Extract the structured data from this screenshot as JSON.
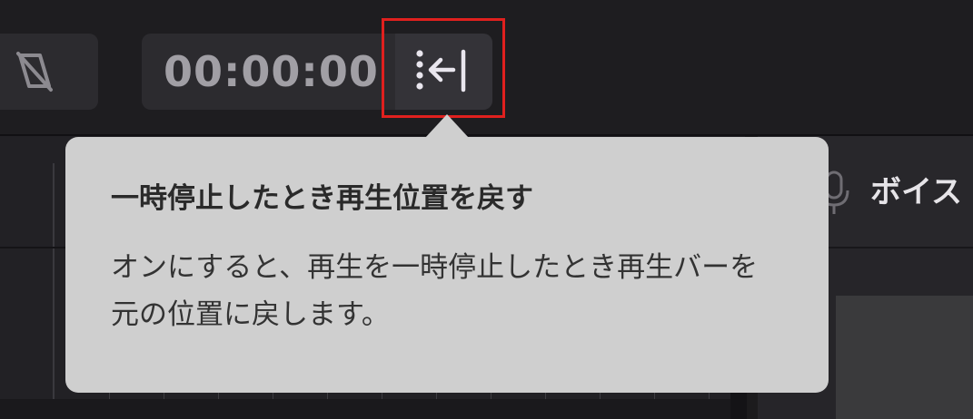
{
  "toolbar": {
    "left_tool_icon": "ripple-edit-icon",
    "timecode": "00:00:00",
    "return_button_icon": "return-to-start-icon",
    "highlight_color": "#e0201e"
  },
  "right_panel": {
    "mic_icon": "microphone-icon",
    "voice_label": "ボイス"
  },
  "tooltip": {
    "title": "一時停止したとき再生位置を戻す",
    "body": "オンにすると、再生を一時停止したとき再生バーを元の位置に戻します。"
  }
}
